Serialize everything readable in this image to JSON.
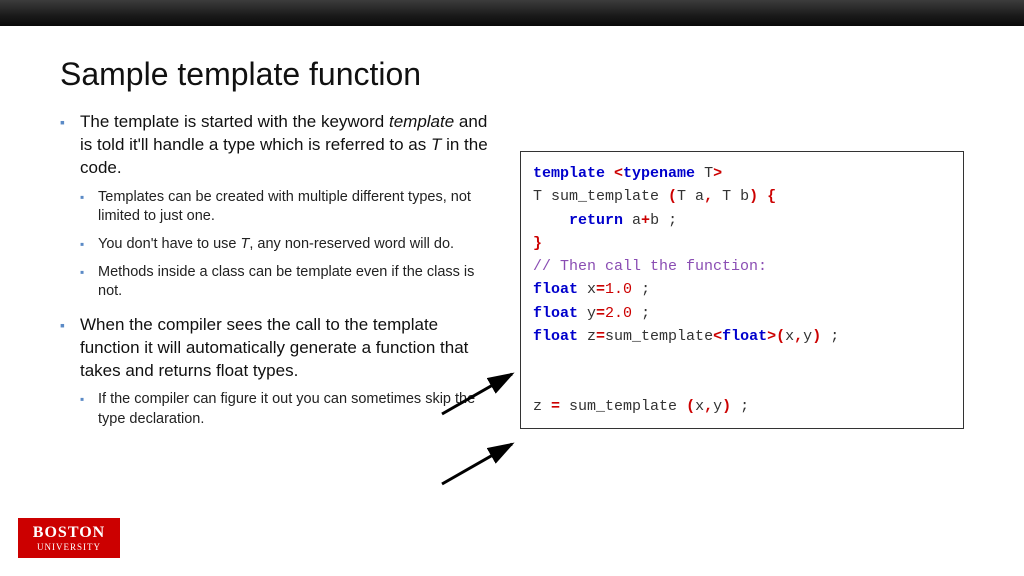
{
  "title": "Sample template function",
  "bullets": {
    "b1_pre": "The template is started with the keyword ",
    "b1_kw": "template",
    "b1_mid": " and is told it'll handle a type which is referred to as ",
    "b1_t": "T",
    "b1_post": " in the code.",
    "b1_sub1": "Templates can be created with multiple different types, not limited to just one.",
    "b1_sub2_pre": "You don't have to use ",
    "b1_sub2_t": "T",
    "b1_sub2_post": ", any non-reserved word will do.",
    "b1_sub3": "Methods inside a class can be template even if the class is not.",
    "b2": "When the compiler sees the call to the template function it will automatically generate a function that takes and returns float types.",
    "b2_sub1": "If the compiler can figure it out you can sometimes skip the type declaration."
  },
  "code": {
    "template": "template",
    "lt": "<",
    "typename": "typename",
    "T": " T",
    "gt": ">",
    "sig1": "T sum_template ",
    "lp": "(",
    "args": "T a",
    "comma": ",",
    "args2": " T b",
    "rp": ")",
    "lb": " {",
    "indent": "    ",
    "return": "return",
    "expr1": " a",
    "plus": "+",
    "expr2": "b ;",
    "rb": "}",
    "comment": "// Then call the function:",
    "float": "float",
    "xeq": " x",
    "eq": "=",
    "v1": "1.0",
    "semi": " ;",
    "yeq": " y",
    "v2": "2.0",
    "zeq": " z",
    "call1": "sum_template",
    "ltf": "<",
    "floattype": "float",
    "gtf": ">",
    "lpc": "(",
    "xy": "x",
    "cc": ",",
    "xy2": "y",
    "rpc": ")",
    "line_z2a": "z ",
    "line_z2b": " sum_template ",
    "line_z2c": "x",
    "line_z2d": "y",
    "line_z2e": " ;"
  },
  "logo": {
    "l1": "BOSTON",
    "l2": "UNIVERSITY"
  }
}
